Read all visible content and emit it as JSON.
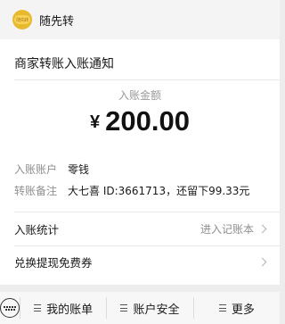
{
  "header": {
    "app_name": "随先转",
    "logo_text": "随先转"
  },
  "card": {
    "title": "商家转账入账通知",
    "amount_label": "入账金额",
    "currency": "¥",
    "amount": "200.00",
    "details": [
      {
        "key": "入账账户",
        "value": "零钱"
      },
      {
        "key": "转账备注",
        "value": "大七喜 ID:3661713，还留下99.33元"
      }
    ],
    "stats": {
      "label": "入账统计",
      "action": "进入记账本"
    },
    "exchange": {
      "label": "兑换提现免费券"
    }
  },
  "bottom_bar": {
    "items": [
      "我的账单",
      "账户安全",
      "更多"
    ]
  }
}
